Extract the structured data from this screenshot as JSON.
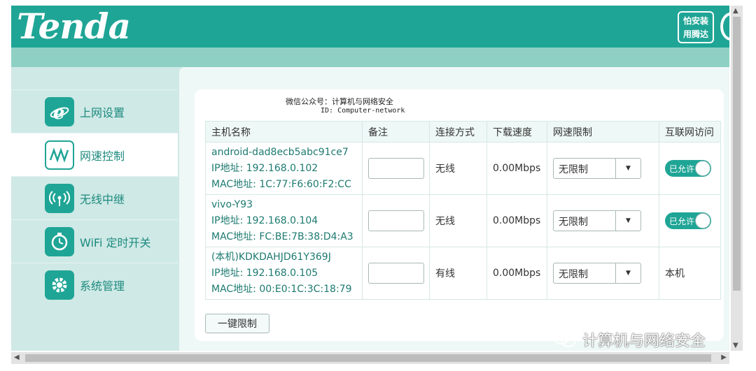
{
  "header": {
    "logo": "Tenda",
    "slogan_line1": "怕安装",
    "slogan_line2": "用腾达"
  },
  "sidebar": {
    "items": [
      {
        "label": "上网设置",
        "icon": "ie-browser-icon"
      },
      {
        "label": "网速控制",
        "icon": "speed-wave-icon"
      },
      {
        "label": "无线中继",
        "icon": "wireless-signal-icon"
      },
      {
        "label": "WiFi 定时开关",
        "icon": "timer-icon"
      },
      {
        "label": "系统管理",
        "icon": "gear-icon"
      }
    ]
  },
  "watermark": {
    "line1": "微信公众号：计算机与网络安全",
    "line2": "ID: Computer-network",
    "bottom": "计算机与网络安全"
  },
  "table": {
    "headers": [
      "主机名称",
      "备注",
      "连接方式",
      "下载速度",
      "网速限制",
      "互联网访问"
    ],
    "rows": [
      {
        "name": "android-dad8ecb5abc91ce7",
        "ip": "IP地址: 192.168.0.102",
        "mac": "MAC地址: 1C:77:F6:60:F2:CC",
        "note": "",
        "connection": "无线",
        "speed": "0.00Mbps",
        "limit": "无限制",
        "access": "已允许"
      },
      {
        "name": "vivo-Y93",
        "ip": "IP地址: 192.168.0.104",
        "mac": "MAC地址: FC:BE:7B:38:D4:A3",
        "note": "",
        "connection": "无线",
        "speed": "0.00Mbps",
        "limit": "无限制",
        "access": "已允许"
      },
      {
        "name": "(本机)KDKDAHJD61Y369J",
        "ip": "IP地址: 192.168.0.105",
        "mac": "MAC地址: 00:E0:1C:3C:18:79",
        "note": "",
        "connection": "有线",
        "speed": "0.00Mbps",
        "limit": "无限制",
        "access": "本机"
      }
    ]
  },
  "actions": {
    "bulk_limit": "一键限制"
  },
  "colors": {
    "brand": "#1fa596",
    "brand_light": "#cfe9e6",
    "panel": "#eef8f6"
  }
}
